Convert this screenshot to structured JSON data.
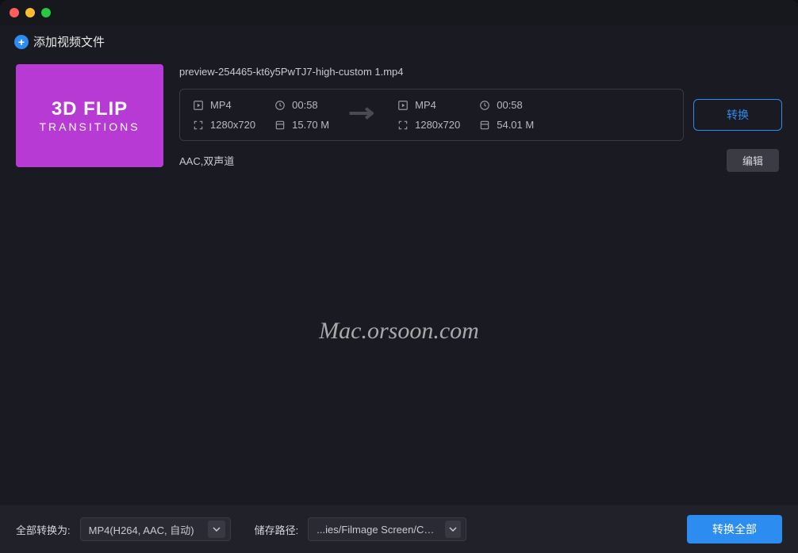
{
  "header": {
    "add_label": "添加视频文件"
  },
  "file": {
    "thumb_line1": "3D FLIP",
    "thumb_line2": "TRANSITIONS",
    "name": "preview-254465-kt6y5PwTJ7-high-custom 1.mp4",
    "source": {
      "format": "MP4",
      "duration": "00:58",
      "resolution": "1280x720",
      "size": "15.70 M"
    },
    "target": {
      "format": "MP4",
      "duration": "00:58",
      "resolution": "1280x720",
      "size": "54.01 M"
    },
    "audio": "AAC,双声道",
    "edit_label": "编辑",
    "convert_label": "转换"
  },
  "watermark": "Mac.orsoon.com",
  "footer": {
    "format_prefix": "全部转换为:",
    "format_value": "MP4(H264, AAC, 自动)",
    "path_prefix": "储存路径:",
    "path_value": "...ies/Filmage Screen/Convert",
    "convert_all_label": "转换全部"
  }
}
